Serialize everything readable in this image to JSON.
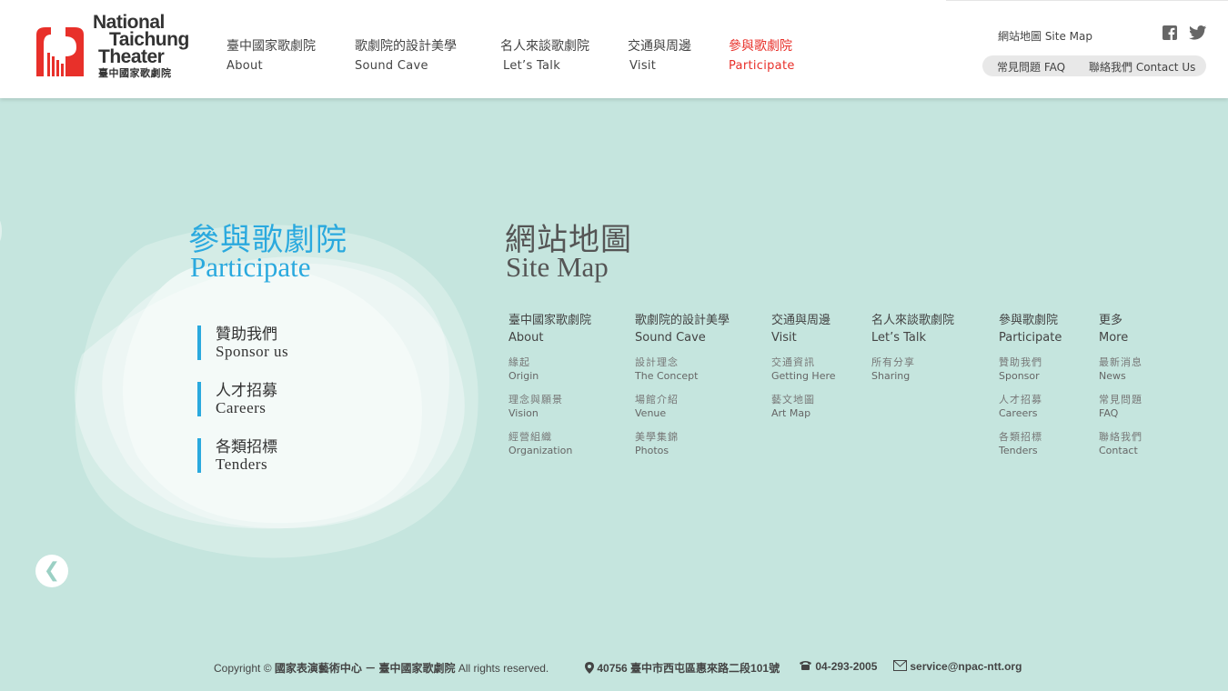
{
  "header": {
    "logo": {
      "line1": "National",
      "line2": "Taichung",
      "line3": "Theater",
      "line4": "臺中國家歌劇院"
    },
    "nav": [
      {
        "zh": "臺中國家歌劇院",
        "en": "About"
      },
      {
        "zh": "歌劇院的設計美學",
        "en": "Sound Cave"
      },
      {
        "zh": "名人來談歌劇院",
        "en": "Let’s Talk"
      },
      {
        "zh": "交通與周邊",
        "en": "Visit"
      },
      {
        "zh": "參與歌劇院",
        "en": "Participate"
      }
    ],
    "sitemap_link": "網站地圖 Site Map",
    "faq_link": "常見問題 FAQ",
    "contact_link": "聯絡我們 Contact Us",
    "active_color": "#e8302a"
  },
  "participate": {
    "title_zh": "參與歌劇院",
    "title_en": "Participate",
    "links": [
      {
        "zh": "贊助我們",
        "en": "Sponsor us"
      },
      {
        "zh": "人才招募",
        "en": "Careers"
      },
      {
        "zh": "各類招標",
        "en": "Tenders"
      }
    ],
    "accent_color": "#2aa9de"
  },
  "sitemap": {
    "title_zh": "網站地圖",
    "title_en": "Site Map",
    "columns": [
      {
        "zh": "臺中國家歌劇院",
        "en": "About",
        "items": [
          {
            "zh": "緣起",
            "en": "Origin"
          },
          {
            "zh": "理念與願景",
            "en": "Vision"
          },
          {
            "zh": "經營組織",
            "en": "Organization"
          }
        ]
      },
      {
        "zh": "歌劇院的設計美學",
        "en": "Sound Cave",
        "items": [
          {
            "zh": "設計理念",
            "en": "The Concept"
          },
          {
            "zh": "場館介紹",
            "en": "Venue"
          },
          {
            "zh": "美學集錦",
            "en": "Photos"
          }
        ]
      },
      {
        "zh": "交通與周邊",
        "en": "Visit",
        "items": [
          {
            "zh": "交通資訊",
            "en": "Getting Here"
          },
          {
            "zh": "藝文地圖",
            "en": "Art Map"
          }
        ]
      },
      {
        "zh": "名人來談歌劇院",
        "en": "Let’s Talk",
        "items": [
          {
            "zh": "所有分享",
            "en": "Sharing"
          }
        ]
      },
      {
        "zh": "參與歌劇院",
        "en": "Participate",
        "items": [
          {
            "zh": "贊助我們",
            "en": "Sponsor"
          },
          {
            "zh": "人才招募",
            "en": "Careers"
          },
          {
            "zh": "各類招標",
            "en": "Tenders"
          }
        ]
      },
      {
        "zh": "更多",
        "en": "More",
        "items": [
          {
            "zh": "最新消息",
            "en": "News"
          },
          {
            "zh": "常見問題",
            "en": "FAQ"
          },
          {
            "zh": "聯絡我們",
            "en": "Contact"
          }
        ]
      }
    ]
  },
  "prev_button": "❮",
  "footer": {
    "copyright_prefix": "Copyright © ",
    "org": "國家表演藝術中心 － 臺中國家歌劇院",
    "rights": " All rights reserved.",
    "address": "40756 臺中市西屯區惠來路二段101號",
    "phone": "04-293-2005",
    "email": "service@npac-ntt.org"
  },
  "background_color": "#c5e5de"
}
